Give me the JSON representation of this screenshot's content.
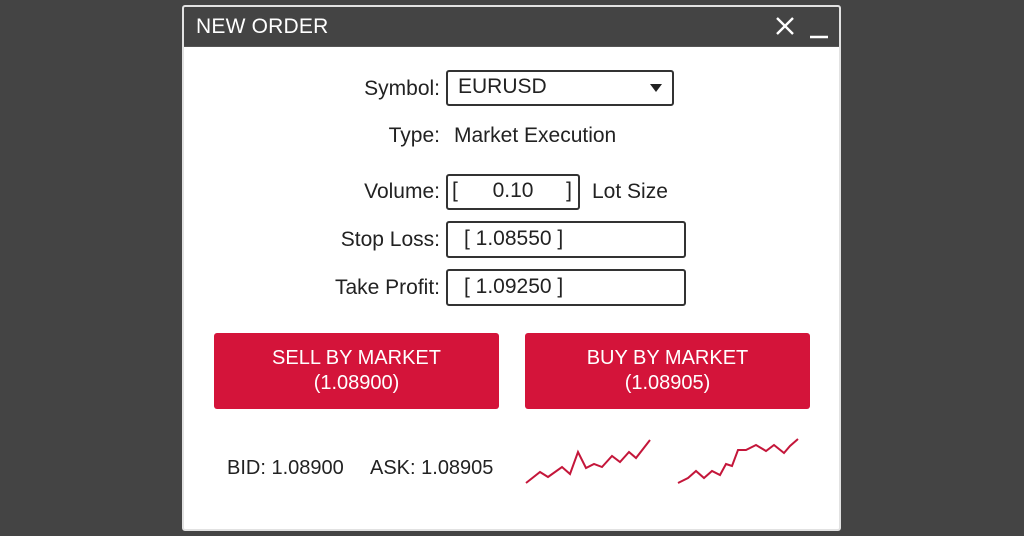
{
  "window": {
    "title": "NEW ORDER",
    "close_icon": "close-icon",
    "minimize_icon": "minimize-icon"
  },
  "form": {
    "symbol_label": "Symbol:",
    "symbol_value": "EURUSD",
    "type_label": "Type:",
    "type_value": "Market Execution",
    "volume_label": "Volume:",
    "volume_bracket_open": "[",
    "volume_value": "0.10",
    "volume_bracket_close": "]",
    "volume_unit": "Lot Size",
    "stop_loss_label": "Stop Loss:",
    "stop_loss_value": "[ 1.08550 ]",
    "take_profit_label": "Take Profit:",
    "take_profit_value": "[ 1.09250 ]"
  },
  "actions": {
    "sell_label": "SELL BY MARKET",
    "sell_price": "(1.08900)",
    "buy_label": "BUY BY MARKET",
    "buy_price": "(1.08905)"
  },
  "quotes": {
    "bid": "BID: 1.08900",
    "ask": "ASK: 1.08905"
  },
  "colors": {
    "accent": "#d4143a",
    "background": "#444444",
    "sparkline": "#c4163a"
  }
}
